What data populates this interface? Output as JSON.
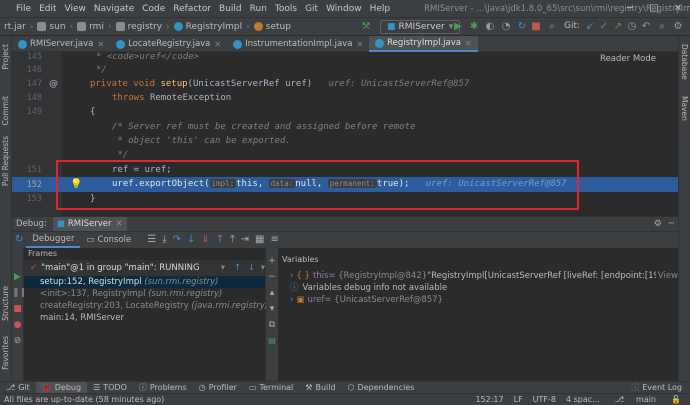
{
  "menu": {
    "items": [
      "File",
      "Edit",
      "View",
      "Navigate",
      "Code",
      "Refactor",
      "Build",
      "Run",
      "Tools",
      "Git",
      "Window",
      "Help"
    ],
    "title": "RMIServer - ...\\Java\\jdk1.8.0_65\\src\\sun\\rmi\\registry\\RegistryImpl.java"
  },
  "navbar": {
    "crumbs": [
      "rt.jar",
      "sun",
      "rmi",
      "registry",
      "RegistryImpl",
      "setup"
    ],
    "run_config": "RMIServer",
    "git_label": "Git:"
  },
  "tool_windows": {
    "left": [
      "Project",
      "Commit",
      "Pull Requests",
      "Structure",
      "Favorites"
    ],
    "right": [
      "Database",
      "Maven"
    ]
  },
  "tabs": [
    {
      "label": "RMIServer.java",
      "color": "#3592c4",
      "active": false
    },
    {
      "label": "LocateRegistry.java",
      "color": "#3592c4",
      "active": false
    },
    {
      "label": "InstrumentationImpl.java",
      "color": "#3592c4",
      "active": false
    },
    {
      "label": "RegistryImpl.java",
      "color": "#3592c4",
      "active": true
    }
  ],
  "editor": {
    "reader_mode": "Reader Mode",
    "line_numbers": [
      "145",
      "146",
      "147",
      "148",
      "149",
      "150",
      "151",
      "152",
      "153"
    ],
    "l145": "* <code>uref</code>",
    "l146": "*/",
    "l147_kw": "private void ",
    "l147_fn": "setup",
    "l147_rest": "(UnicastServerRef uref)",
    "l147_hint": "uref: UnicastServerRef@857",
    "l148_kw": "throws ",
    "l148_rest": "RemoteException",
    "l149": "{",
    "l150a": "/* Server ref must be created and assigned before remote",
    "l150b": " * object 'this' can be exported.",
    "l150c": " */",
    "l151": "ref = uref;",
    "l152_a": "uref.exportObject(",
    "l152_p1": "impl:",
    "l152_v1": "this",
    "l152_p2": "data:",
    "l152_v2": "null",
    "l152_p3": "permanent:",
    "l152_v3": "true",
    "l152_end": ");",
    "l152_hint": "uref: UnicastServerRef@857",
    "l153": "}"
  },
  "debug": {
    "label": "Debug:",
    "config": "RMIServer",
    "tab_debugger": "Debugger",
    "tab_console": "Console",
    "frames_header": "Frames",
    "thread": "\"main\"@1 in group \"main\": RUNNING",
    "frames": [
      {
        "method": "setup:152, RegistryImpl",
        "pkg": "(sun.rmi.registry)",
        "state": "sel"
      },
      {
        "method": "<init>:137, RegistryImpl",
        "pkg": "(sun.rmi.registry)",
        "state": "dim"
      },
      {
        "method": "createRegistry:203, LocateRegistry",
        "pkg": "(java.rmi.registry)",
        "state": "dim"
      },
      {
        "method": "main:14, RMIServer",
        "pkg": "",
        "state": "normal"
      }
    ],
    "variables_header": "Variables",
    "variables": [
      {
        "name": "this",
        "type": " = {RegistryImpl@842} ",
        "value": "\"RegistryImpl[UnicastServerRef [liveRef: [endpoint:[192.168.5.3:1099](local),objID:[0:0:0...",
        "extra": "View"
      },
      {
        "name": "",
        "type": "",
        "value": "Variables debug info not available",
        "extra": ""
      },
      {
        "name": "uref",
        "type": " = {UnicastServerRef@857}",
        "value": "",
        "extra": ""
      }
    ]
  },
  "bottom_tabs": [
    {
      "label": "Git",
      "icon": "⎇"
    },
    {
      "label": "Debug",
      "icon": "🐞"
    },
    {
      "label": "TODO",
      "icon": "☰"
    },
    {
      "label": "Problems",
      "icon": "ⓘ"
    },
    {
      "label": "Profiler",
      "icon": "◷"
    },
    {
      "label": "Terminal",
      "icon": "▭"
    },
    {
      "label": "Build",
      "icon": "⚒"
    },
    {
      "label": "Dependencies",
      "icon": "⬡"
    }
  ],
  "event_log": "Event Log",
  "status": {
    "message": "All files are up-to-date (58 minutes ago)",
    "position": "152:17",
    "line_sep": "LF",
    "encoding": "UTF-8",
    "indent": "4 spac...",
    "branch": "main"
  },
  "colors": {
    "exec_line": "#2d5c9c",
    "highlight_box": "#e0262c",
    "keyword": "#cc7832",
    "method": "#ffc66d"
  }
}
